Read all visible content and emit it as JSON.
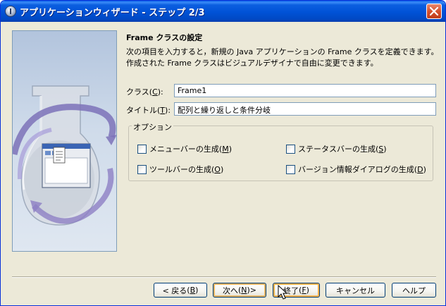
{
  "window": {
    "title": "アプリケーションウィザード - ステップ 2/3"
  },
  "content": {
    "section_title": "Frame クラスの設定",
    "description_line1": "次の項目を入力すると，新規の Java アプリケーションの Frame クラスを定義できます。",
    "description_line2": "作成された Frame クラスはビジュアルデザイナで自由に変更できます。",
    "class_field": {
      "label": "クラス",
      "mnemonic": "C",
      "value": "Frame1"
    },
    "title_field": {
      "label": "タイトル",
      "mnemonic": "T",
      "value": "配列と繰り返しと条件分岐"
    },
    "options": {
      "legend": "オプション",
      "items": [
        {
          "label": "メニューバーの生成",
          "mnemonic": "M",
          "checked": false
        },
        {
          "label": "ステータスバーの生成",
          "mnemonic": "S",
          "checked": false
        },
        {
          "label": "ツールバーの生成",
          "mnemonic": "O",
          "checked": false
        },
        {
          "label": "バージョン情報ダイアログの生成",
          "mnemonic": "D",
          "checked": false
        }
      ]
    }
  },
  "buttons": {
    "back": {
      "prefix": "< 戻る",
      "mnemonic": "B"
    },
    "next": {
      "prefix": "次へ",
      "mnemonic": "N",
      "suffix": " >"
    },
    "finish": {
      "prefix": "終了",
      "mnemonic": "F"
    },
    "cancel": {
      "label": "キャンセル"
    },
    "help": {
      "label": "ヘルプ"
    }
  },
  "colors": {
    "titlebar": "#0052d6",
    "dialog_bg": "#ece9d8",
    "field_border": "#7f9db9",
    "close_button": "#d5512e"
  }
}
